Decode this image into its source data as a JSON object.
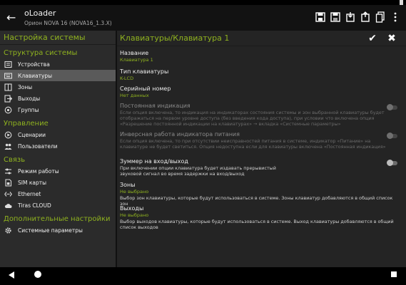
{
  "app": {
    "title": "oLoader",
    "subtitle": "Орион NOVA 16 (NOVA16_1.3.X)"
  },
  "toolbar_icons": [
    "save-icon",
    "save-as-icon",
    "device-read-icon",
    "device-write-icon",
    "copy-icon",
    "more-vert-icon"
  ],
  "sidebar": {
    "header": "Настройка системы",
    "sections": [
      {
        "title": "Структура системы",
        "items": [
          {
            "label": "Устройства",
            "icon": "devices-icon",
            "selected": false
          },
          {
            "label": "Клавиатуры",
            "icon": "keyboard-icon",
            "selected": true
          },
          {
            "label": "Зоны",
            "icon": "zones-icon",
            "selected": false
          },
          {
            "label": "Выходы",
            "icon": "outputs-icon",
            "selected": false
          },
          {
            "label": "Группы",
            "icon": "groups-icon",
            "selected": false
          }
        ]
      },
      {
        "title": "Управление",
        "items": [
          {
            "label": "Сценарии",
            "icon": "scenarios-icon",
            "selected": false
          },
          {
            "label": "Пользователи",
            "icon": "users-icon",
            "selected": false
          }
        ]
      },
      {
        "title": "Связь",
        "items": [
          {
            "label": "Режим работы",
            "icon": "mode-icon",
            "selected": false
          },
          {
            "label": "SIM карты",
            "icon": "sim-icon",
            "selected": false
          },
          {
            "label": "Ethernet",
            "icon": "ethernet-icon",
            "selected": false
          },
          {
            "label": "Tiras CLOUD",
            "icon": "cloud-icon",
            "selected": false
          }
        ]
      },
      {
        "title": "Дополнительные настройки",
        "items": [
          {
            "label": "Системные параметры",
            "icon": "gear-icon",
            "selected": false
          }
        ]
      }
    ]
  },
  "content": {
    "title": "Клавиатуры/Клавиатура 1",
    "rows": [
      {
        "label": "Название",
        "value": "Клавиатура 1"
      },
      {
        "label": "Тип клавиатуры",
        "value": "K-LCD"
      },
      {
        "label": "Серийный номер",
        "value": "Нет данных"
      },
      {
        "label": "Постоянная индикация",
        "desc": "Если опция включена, то индикация на индикаторах состояния системы и зон выбранной клавиатуры будет отображаться на первом уровне доступа (без введения кода доступа), при условии что включена опция «Разрешение постоянной индикации на клавиатурах» → вкладка «Системные параметры»",
        "toggle": false,
        "disabled": true
      },
      {
        "label": "Инверсная работа индикатора питания",
        "desc": "Если опция включена, то при отсутствии неисправностей питания в системе, индикатор «Питание» на клавиатуре не будет светиться. Опция недоступна если для клавиатуры включена «Постоянная индикация»",
        "toggle": false,
        "disabled": true
      },
      {
        "label": "Зуммер на вход/выход",
        "desc": "При включении опции клавиатура будет издавать прерывистый звуковой сигнал во время задержки на вход/выход",
        "toggle": false,
        "disabled": false
      },
      {
        "label": "Зоны",
        "value": "Не выбрано",
        "desc": "Выбор зон клавиатуры, которые будут использоваться в системе. Зоны клавиатур добавляются в общий список зон"
      },
      {
        "label": "Выходы",
        "value": "Не выбрано",
        "desc": "Выбор выходов клавиатуры, которые будут использоваться в системе. Выход клавиатуры добавляются в общий список выходов"
      }
    ]
  },
  "colors": {
    "accent": "#8fb21f",
    "sidebar_bg": "#2b2b2b",
    "content_bg": "#242424",
    "appbar_bg": "#121212"
  }
}
